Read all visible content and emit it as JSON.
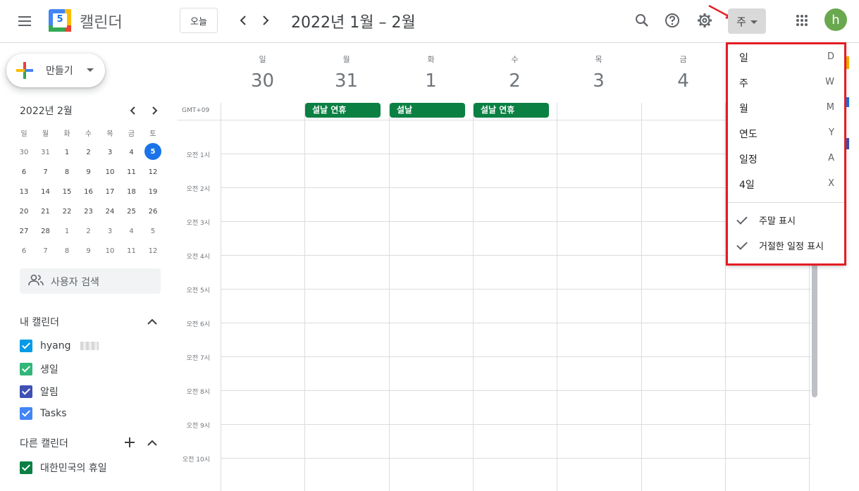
{
  "header": {
    "app_name": "캘린더",
    "logo_number": "5",
    "today_button": "오늘",
    "date_range": "2022년 1월 – 2월",
    "view_button": "주",
    "avatar_letter": "h"
  },
  "sidebar": {
    "create_button": "만들기",
    "mini_calendar": {
      "title": "2022년 2월",
      "weekdays": [
        "일",
        "월",
        "화",
        "수",
        "목",
        "금",
        "토"
      ],
      "weeks": [
        [
          "30",
          "31",
          "1",
          "2",
          "3",
          "4",
          "5"
        ],
        [
          "6",
          "7",
          "8",
          "9",
          "10",
          "11",
          "12"
        ],
        [
          "13",
          "14",
          "15",
          "16",
          "17",
          "18",
          "19"
        ],
        [
          "20",
          "21",
          "22",
          "23",
          "24",
          "25",
          "26"
        ],
        [
          "27",
          "28",
          "1",
          "2",
          "3",
          "4",
          "5"
        ],
        [
          "6",
          "7",
          "8",
          "9",
          "10",
          "11",
          "12"
        ]
      ],
      "today": "5"
    },
    "search_people": "사용자 검색",
    "my_calendars": {
      "title": "내 캘린더",
      "items": [
        {
          "label": "hyang",
          "color": "#039be5"
        },
        {
          "label": "생일",
          "color": "#33b679"
        },
        {
          "label": "알림",
          "color": "#3f51b5"
        },
        {
          "label": "Tasks",
          "color": "#4285f4"
        }
      ]
    },
    "other_calendars": {
      "title": "다른 캘린더",
      "items": [
        {
          "label": "대한민국의 휴일",
          "color": "#0b8043"
        }
      ]
    }
  },
  "grid": {
    "timezone": "GMT+09",
    "days": [
      {
        "name": "일",
        "date": "30"
      },
      {
        "name": "월",
        "date": "31"
      },
      {
        "name": "화",
        "date": "1"
      },
      {
        "name": "수",
        "date": "2"
      },
      {
        "name": "목",
        "date": "3"
      },
      {
        "name": "금",
        "date": "4"
      }
    ],
    "times": [
      "오전 1시",
      "오전 2시",
      "오전 3시",
      "오전 4시",
      "오전 5시",
      "오전 6시",
      "오전 7시",
      "오전 8시",
      "오전 9시",
      "오전 10시"
    ],
    "events": [
      {
        "label": "설날 연휴",
        "color": "#0b8043"
      },
      {
        "label": "설날",
        "color": "#0b8043"
      },
      {
        "label": "설날 연휴",
        "color": "#0b8043"
      }
    ]
  },
  "view_menu": {
    "items": [
      {
        "label": "일",
        "key": "D"
      },
      {
        "label": "주",
        "key": "W"
      },
      {
        "label": "월",
        "key": "M"
      },
      {
        "label": "연도",
        "key": "Y"
      },
      {
        "label": "일정",
        "key": "A"
      },
      {
        "label": "4일",
        "key": "X"
      }
    ],
    "toggles": [
      {
        "label": "주말 표시",
        "checked": true
      },
      {
        "label": "거절한 일정 표시",
        "checked": true
      }
    ]
  },
  "colors": {
    "highlight_box": "#e51c23",
    "arrow": "#e51c23",
    "today_circle": "#1a73e8",
    "holiday": "#0b8043"
  }
}
